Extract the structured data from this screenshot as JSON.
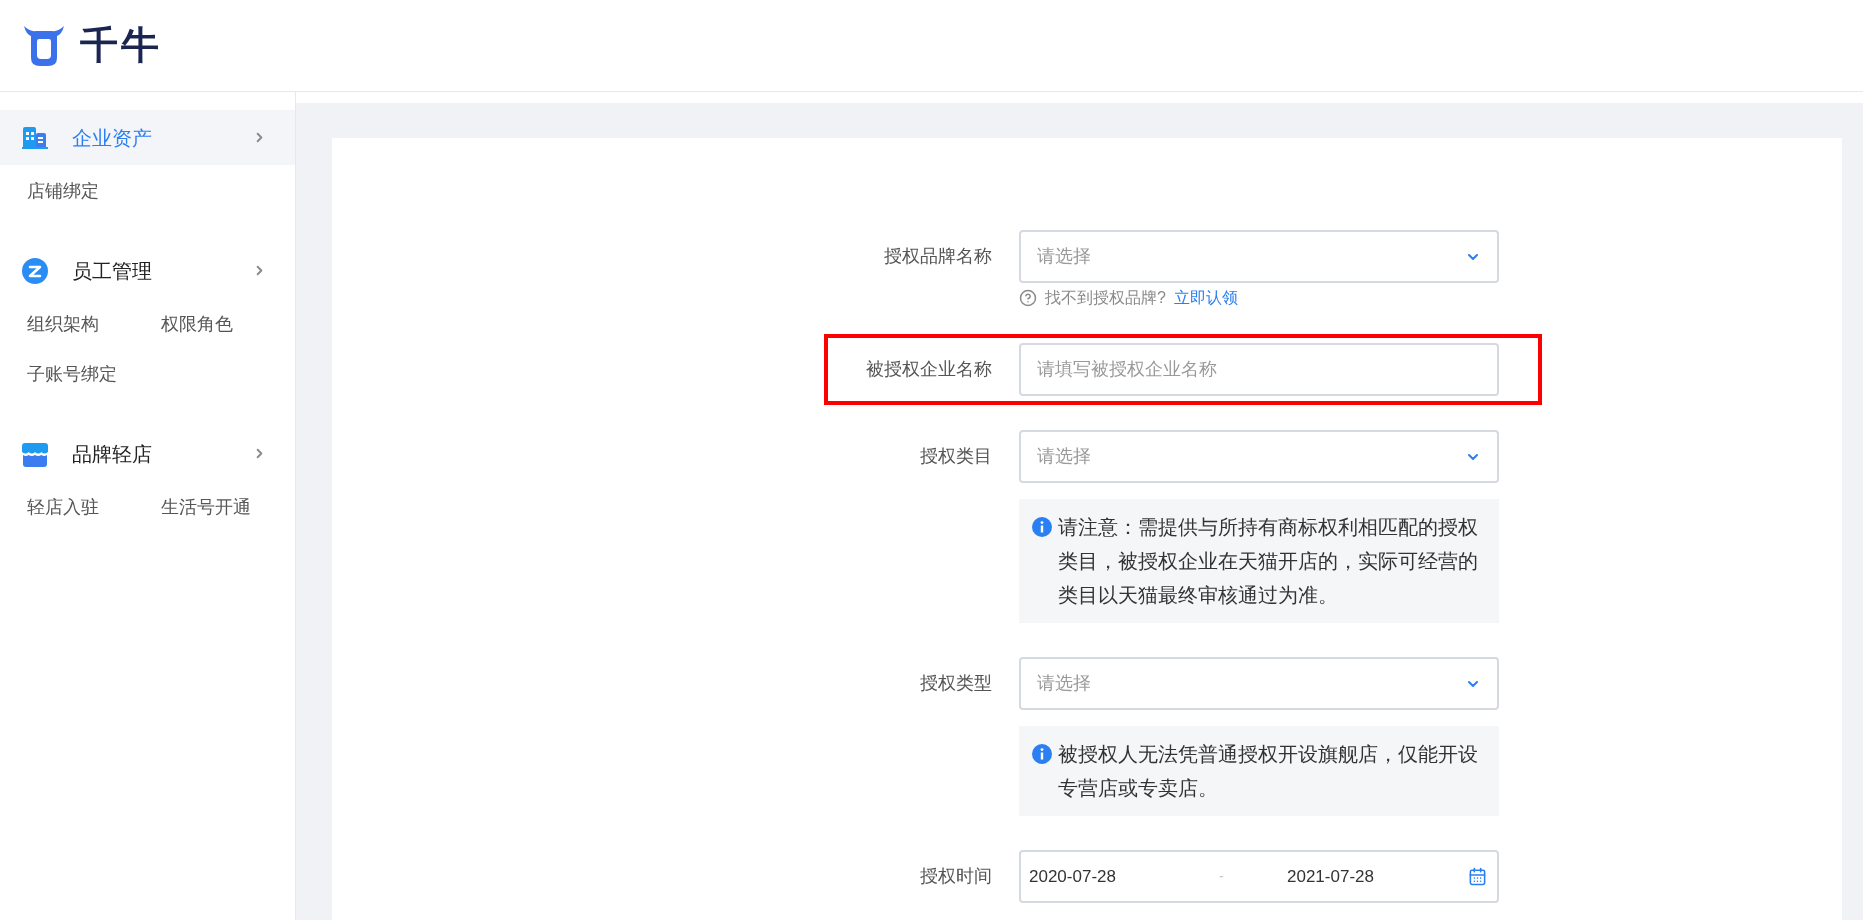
{
  "header": {
    "logo_text": "千牛"
  },
  "sidebar": {
    "groups": [
      {
        "title": "企业资产",
        "selected": true,
        "items": [
          "店铺绑定"
        ]
      },
      {
        "title": "员工管理",
        "selected": false,
        "items": [
          "组织架构",
          "权限角色",
          "子账号绑定"
        ]
      },
      {
        "title": "品牌轻店",
        "selected": false,
        "items": [
          "轻店入驻",
          "生活号开通"
        ]
      }
    ]
  },
  "form": {
    "rows": [
      {
        "label": "授权品牌名称",
        "kind": "select",
        "placeholder": "请选择",
        "highlighted": false,
        "hint": {
          "text": "找不到授权品牌?",
          "link": "立即认领"
        }
      },
      {
        "label": "被授权企业名称",
        "kind": "input",
        "placeholder": "请填写被授权企业名称",
        "highlighted": true
      },
      {
        "label": "授权类目",
        "kind": "select",
        "placeholder": "请选择",
        "highlighted": false,
        "note": "请注意：需提供与所持有商标权利相匹配的授权类目，被授权企业在天猫开店的，实际可经营的类目以天猫最终审核通过为准。"
      },
      {
        "label": "授权类型",
        "kind": "select",
        "placeholder": "请选择",
        "highlighted": false,
        "note": "被授权人无法凭普通授权开设旗舰店，仅能开设专营店或专卖店。"
      },
      {
        "label": "授权时间",
        "kind": "daterange",
        "start": "2020-07-28",
        "separator": "-",
        "end": "2021-07-28",
        "highlighted": false
      }
    ]
  }
}
